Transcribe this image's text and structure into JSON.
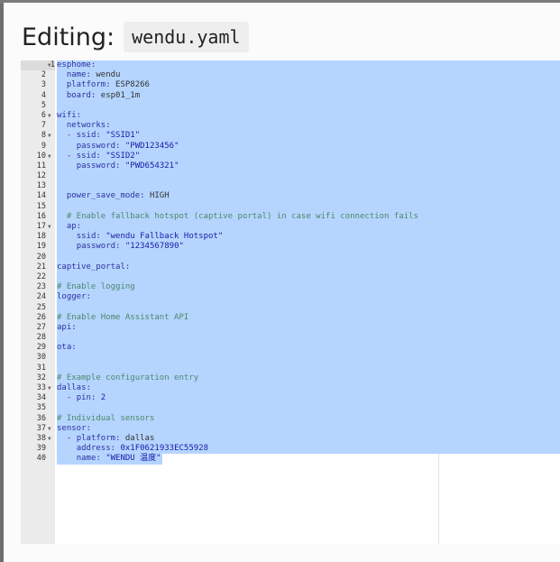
{
  "dialog": {
    "title_prefix": "Editing:",
    "filename": "wendu.yaml"
  },
  "editor": {
    "lines": [
      {
        "n": "1",
        "fold": true,
        "t": [
          [
            "k",
            "esphome:"
          ]
        ]
      },
      {
        "n": "2",
        "t": [
          [
            "v",
            "  "
          ],
          [
            "k",
            "name:"
          ],
          [
            "v",
            " wendu"
          ]
        ]
      },
      {
        "n": "3",
        "t": [
          [
            "v",
            "  "
          ],
          [
            "k",
            "platform:"
          ],
          [
            "v",
            " ESP8266"
          ]
        ]
      },
      {
        "n": "4",
        "t": [
          [
            "v",
            "  "
          ],
          [
            "k",
            "board:"
          ],
          [
            "v",
            " esp01_1m"
          ]
        ]
      },
      {
        "n": "5",
        "t": []
      },
      {
        "n": "6",
        "fold": true,
        "t": [
          [
            "k",
            "wifi:"
          ]
        ]
      },
      {
        "n": "7",
        "t": [
          [
            "v",
            "  "
          ],
          [
            "k",
            "networks:"
          ]
        ]
      },
      {
        "n": "8",
        "fold": true,
        "t": [
          [
            "v",
            "  "
          ],
          [
            "d",
            "-"
          ],
          [
            "v",
            " "
          ],
          [
            "k",
            "ssid:"
          ],
          [
            "s",
            " \"SSID1\""
          ]
        ]
      },
      {
        "n": "9",
        "t": [
          [
            "v",
            "    "
          ],
          [
            "k",
            "password:"
          ],
          [
            "s",
            " \"PWD123456\""
          ]
        ]
      },
      {
        "n": "10",
        "fold": true,
        "t": [
          [
            "v",
            "  "
          ],
          [
            "d",
            "-"
          ],
          [
            "v",
            " "
          ],
          [
            "k",
            "ssid:"
          ],
          [
            "s",
            " \"SSID2\""
          ]
        ]
      },
      {
        "n": "11",
        "t": [
          [
            "v",
            "    "
          ],
          [
            "k",
            "password:"
          ],
          [
            "s",
            " \"PWD654321\""
          ]
        ]
      },
      {
        "n": "12",
        "t": []
      },
      {
        "n": "13",
        "t": []
      },
      {
        "n": "14",
        "t": [
          [
            "v",
            "  "
          ],
          [
            "k",
            "power_save_mode:"
          ],
          [
            "v",
            " HIGH"
          ]
        ]
      },
      {
        "n": "15",
        "t": []
      },
      {
        "n": "16",
        "t": [
          [
            "v",
            "  "
          ],
          [
            "c",
            "# Enable fallback hotspot (captive portal) in case wifi connection fails"
          ]
        ]
      },
      {
        "n": "17",
        "fold": true,
        "t": [
          [
            "v",
            "  "
          ],
          [
            "k",
            "ap:"
          ]
        ]
      },
      {
        "n": "18",
        "t": [
          [
            "v",
            "    "
          ],
          [
            "k",
            "ssid:"
          ],
          [
            "s",
            " \"wendu Fallback Hotspot\""
          ]
        ]
      },
      {
        "n": "19",
        "t": [
          [
            "v",
            "    "
          ],
          [
            "k",
            "password:"
          ],
          [
            "s",
            " \"1234567890\""
          ]
        ]
      },
      {
        "n": "20",
        "t": []
      },
      {
        "n": "21",
        "t": [
          [
            "k",
            "captive_portal:"
          ]
        ]
      },
      {
        "n": "22",
        "t": []
      },
      {
        "n": "23",
        "t": [
          [
            "c",
            "# Enable logging"
          ]
        ]
      },
      {
        "n": "24",
        "t": [
          [
            "k",
            "logger:"
          ]
        ]
      },
      {
        "n": "25",
        "t": []
      },
      {
        "n": "26",
        "t": [
          [
            "c",
            "# Enable Home Assistant API"
          ]
        ]
      },
      {
        "n": "27",
        "t": [
          [
            "k",
            "api:"
          ]
        ]
      },
      {
        "n": "28",
        "t": []
      },
      {
        "n": "29",
        "t": [
          [
            "k",
            "ota:"
          ]
        ]
      },
      {
        "n": "30",
        "t": []
      },
      {
        "n": "31",
        "t": []
      },
      {
        "n": "32",
        "t": [
          [
            "c",
            "# Example configuration entry"
          ]
        ]
      },
      {
        "n": "33",
        "fold": true,
        "t": [
          [
            "k",
            "dallas:"
          ]
        ]
      },
      {
        "n": "34",
        "t": [
          [
            "v",
            "  "
          ],
          [
            "d",
            "-"
          ],
          [
            "v",
            " "
          ],
          [
            "k",
            "pin:"
          ],
          [
            "s",
            " 2"
          ]
        ]
      },
      {
        "n": "35",
        "t": []
      },
      {
        "n": "36",
        "t": [
          [
            "c",
            "# Individual sensors"
          ]
        ]
      },
      {
        "n": "37",
        "fold": true,
        "t": [
          [
            "k",
            "sensor:"
          ]
        ]
      },
      {
        "n": "38",
        "fold": true,
        "t": [
          [
            "v",
            "  "
          ],
          [
            "d",
            "-"
          ],
          [
            "v",
            " "
          ],
          [
            "k",
            "platform:"
          ],
          [
            "v",
            " dallas"
          ]
        ]
      },
      {
        "n": "39",
        "t": [
          [
            "v",
            "    "
          ],
          [
            "k",
            "address:"
          ],
          [
            "s",
            " 0x1F0621933EC55928"
          ]
        ]
      },
      {
        "n": "40",
        "t": [
          [
            "v",
            "    "
          ],
          [
            "k",
            "name:"
          ],
          [
            "s",
            " \"WENDU 温度\""
          ]
        ]
      }
    ]
  }
}
